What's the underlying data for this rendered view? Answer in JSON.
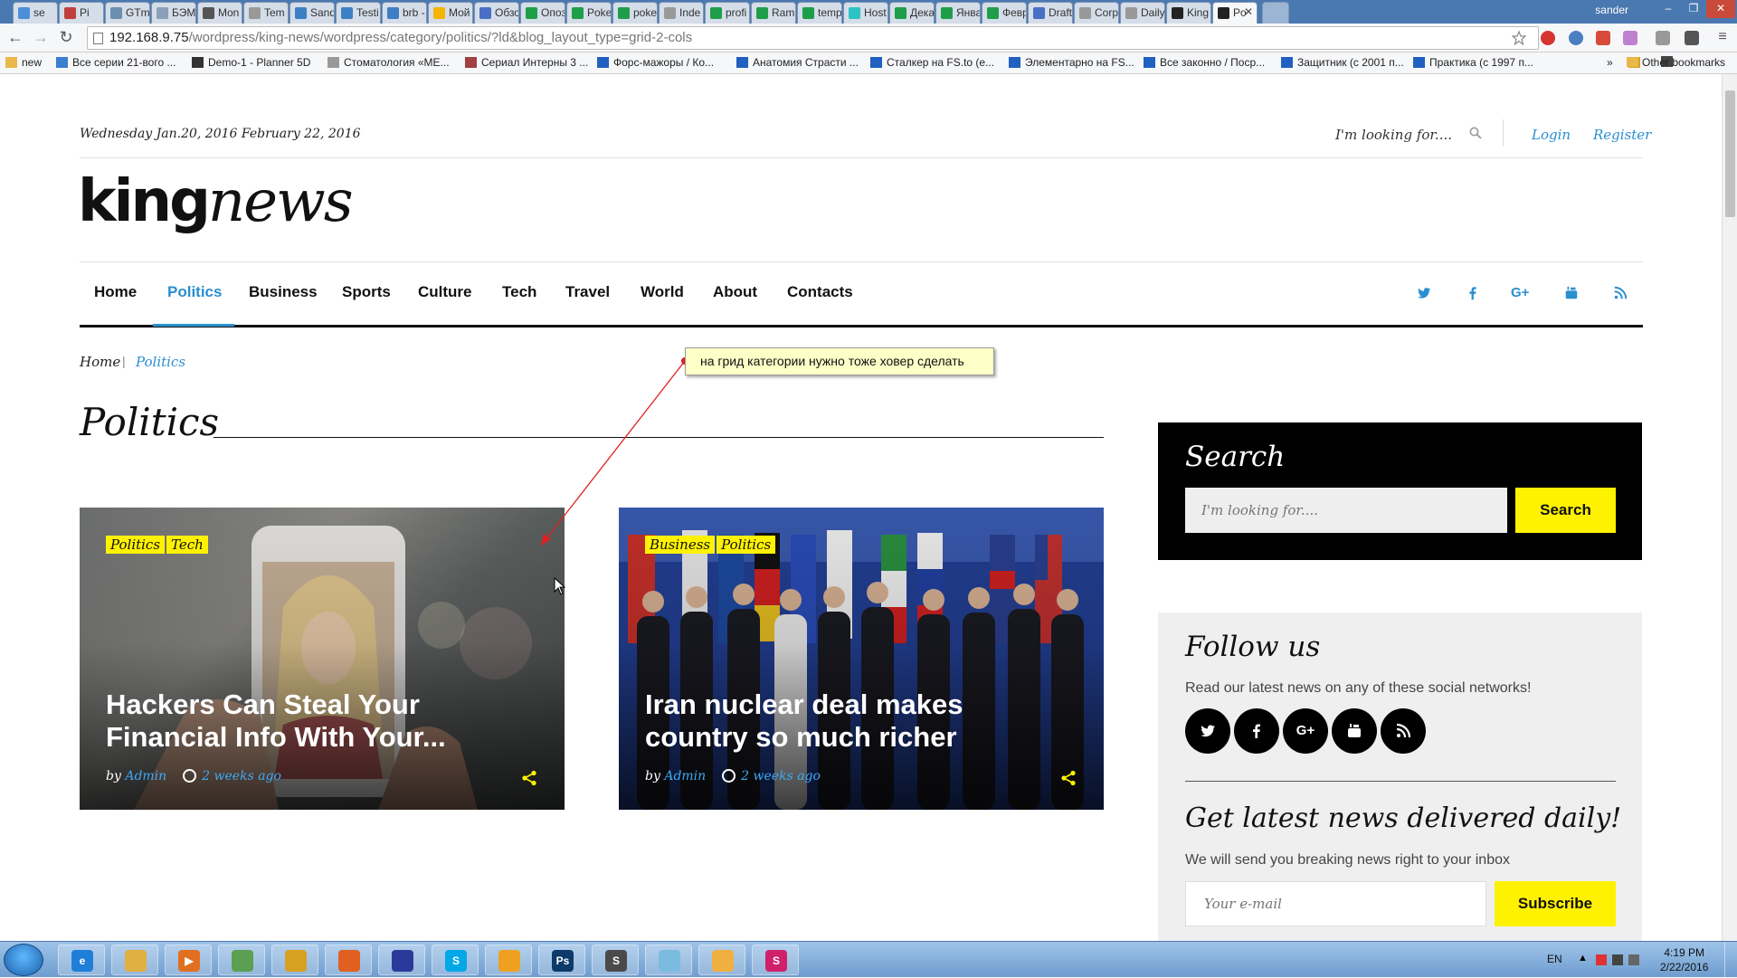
{
  "browser": {
    "tabs": [
      {
        "label": "se",
        "color": "#4a90d9"
      },
      {
        "label": "Pi",
        "color": "#c04040"
      },
      {
        "label": "GTm",
        "color": "#6a8fb0"
      },
      {
        "label": "БЭМ",
        "color": "#8aa0b8"
      },
      {
        "label": "Mon",
        "color": "#555"
      },
      {
        "label": "Tem",
        "color": "#999"
      },
      {
        "label": "Sand",
        "color": "#3d7fc4"
      },
      {
        "label": "Testi",
        "color": "#3d7fc4"
      },
      {
        "label": "brb -",
        "color": "#3d7fc4"
      },
      {
        "label": "Мой",
        "color": "#f4b400"
      },
      {
        "label": "Обзо",
        "color": "#4a6ec4"
      },
      {
        "label": "Опоз",
        "color": "#1e9e49"
      },
      {
        "label": "Poke",
        "color": "#1e9e49"
      },
      {
        "label": "poke",
        "color": "#1e9e49"
      },
      {
        "label": "Inde",
        "color": "#999"
      },
      {
        "label": "profi",
        "color": "#1e9e49"
      },
      {
        "label": "Rami",
        "color": "#1e9e49"
      },
      {
        "label": "temp",
        "color": "#1e9e49"
      },
      {
        "label": "Host",
        "color": "#2bc3c3"
      },
      {
        "label": "Дека",
        "color": "#1e9e49"
      },
      {
        "label": "Янва",
        "color": "#1e9e49"
      },
      {
        "label": "Февр",
        "color": "#1e9e49"
      },
      {
        "label": "Draft",
        "color": "#4a6ec4"
      },
      {
        "label": "Corp",
        "color": "#999"
      },
      {
        "label": "Daily",
        "color": "#999"
      },
      {
        "label": "King",
        "color": "#222"
      },
      {
        "label": "Po",
        "color": "#222"
      }
    ],
    "user": "sander",
    "url_host": "192.168.9.75",
    "url_path": "/wordpress/king-news/wordpress/category/politics/?ld&blog_layout_type=grid-2-cols",
    "bookmarks": [
      "new",
      "Все серии 21-вого ...",
      "Demo-1 - Planner 5D",
      "Стоматология «МЕ...",
      "Сериал Интерны 3 ...",
      "Форс-мажоры / Ко...",
      "Анатомия Страсти ...",
      "Сталкер на FS.to (е...",
      "Элементарно на FS...",
      "Все законно / Поср...",
      "Защитник (с 2001 п...",
      "Практика (с 1997 п..."
    ],
    "bookmarks_more": "»",
    "other_bookmarks": "Other bookmarks"
  },
  "site": {
    "date": "Wednesday Jan.20, 2016 February 22, 2016",
    "search_placeholder": "I'm looking for....",
    "login": "Login",
    "register": "Register",
    "logo_king": "king",
    "logo_news": "news",
    "nav": [
      "Home",
      "Politics",
      "Business",
      "Sports",
      "Culture",
      "Tech",
      "Travel",
      "World",
      "About",
      "Contacts"
    ],
    "active_nav": "Politics",
    "breadcrumb": {
      "home": "Home",
      "sep": "|",
      "current": "Politics"
    },
    "page_title": "Politics",
    "cards": [
      {
        "tags": [
          "Politics",
          "Tech"
        ],
        "title": "Hackers Can Steal Your Financial Info With Your...",
        "by": "by",
        "author": "Admin",
        "time": "2 weeks ago"
      },
      {
        "tags": [
          "Business",
          "Politics"
        ],
        "title": "Iran nuclear deal makes country so much richer",
        "by": "by",
        "author": "Admin",
        "time": "2 weeks ago"
      }
    ],
    "sidebar": {
      "search_title": "Search",
      "search_placeholder": "I'm looking for....",
      "search_button": "Search",
      "follow_title": "Follow us",
      "follow_desc": "Read our latest news on any of these social networks!",
      "newsletter_title": "Get latest news delivered daily!",
      "newsletter_desc": "We will send you breaking news right to your inbox",
      "email_placeholder": "Your e-mail",
      "subscribe_button": "Subscribe"
    }
  },
  "annotation": {
    "note": "на грид категории нужно тоже ховер сделать"
  },
  "taskbar": {
    "lang": "EN",
    "time": "4:19 PM",
    "date": "2/22/2016",
    "apps": [
      {
        "name": "ie",
        "color": "#1f7fd8",
        "glyph": "e"
      },
      {
        "name": "explorer",
        "color": "#e0b040",
        "glyph": ""
      },
      {
        "name": "media",
        "color": "#e07020",
        "glyph": "▶"
      },
      {
        "name": "disk",
        "color": "#5aa050",
        "glyph": ""
      },
      {
        "name": "chrome",
        "color": "#d8a020",
        "glyph": ""
      },
      {
        "name": "firefox",
        "color": "#e06020",
        "glyph": ""
      },
      {
        "name": "save",
        "color": "#2a3a9a",
        "glyph": ""
      },
      {
        "name": "skype",
        "color": "#00a8e8",
        "glyph": "S"
      },
      {
        "name": "app",
        "color": "#f0a020",
        "glyph": ""
      },
      {
        "name": "photoshop",
        "color": "#0c3a6a",
        "glyph": "Ps"
      },
      {
        "name": "sublime",
        "color": "#4a4a4a",
        "glyph": "S"
      },
      {
        "name": "pen",
        "color": "#7abce0",
        "glyph": ""
      },
      {
        "name": "paint",
        "color": "#f0b040",
        "glyph": ""
      },
      {
        "name": "s-app",
        "color": "#d0206a",
        "glyph": "S"
      }
    ]
  },
  "colors": {
    "accent_blue": "#2a8fd0",
    "tag_yellow": "#fff200",
    "dark": "#111111"
  }
}
